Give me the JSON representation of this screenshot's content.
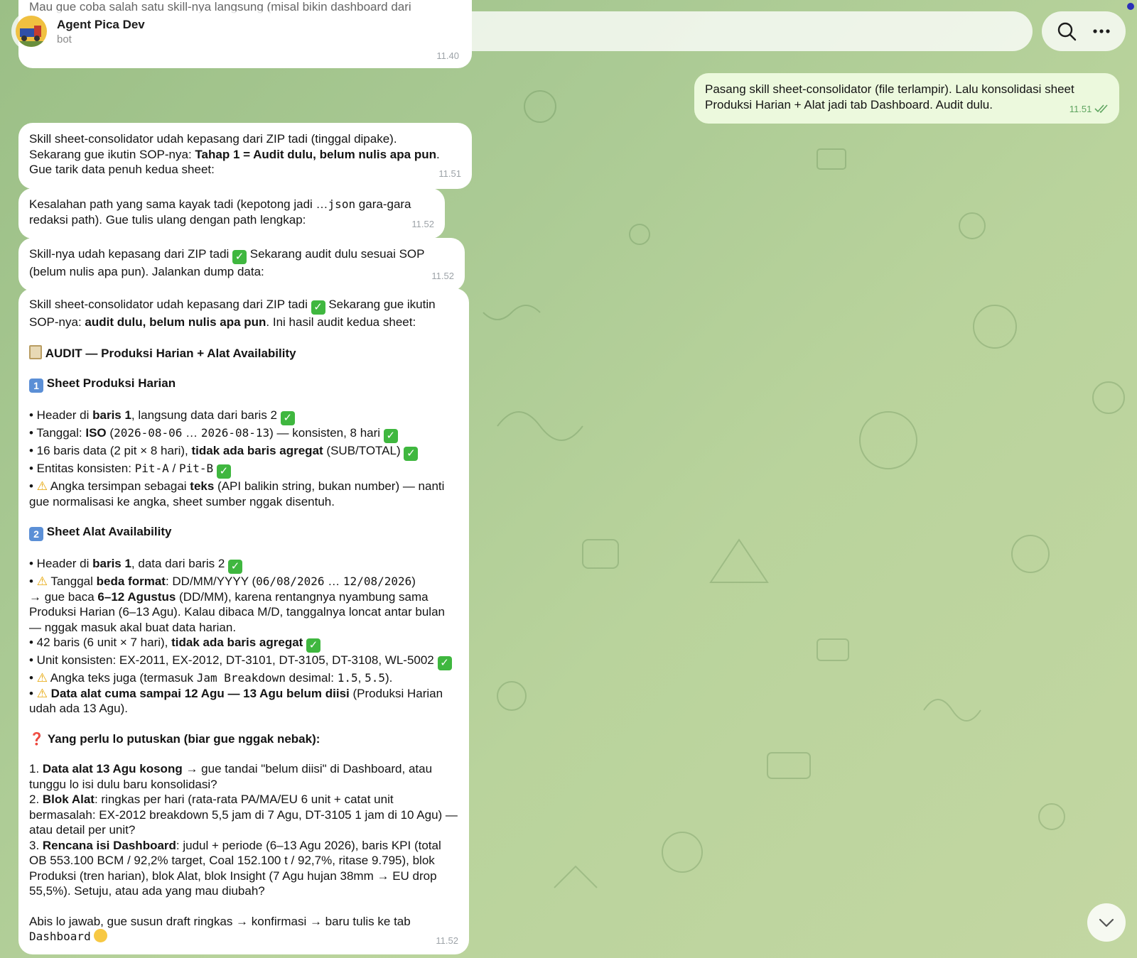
{
  "header": {
    "title": "Agent Pica Dev",
    "subtitle": "bot"
  },
  "top_partial": {
    "text": "Mau gue coba salah satu skill-nya langsung (misal bikin dashboard dari",
    "time": "11.40"
  },
  "outgoing": {
    "text": "Pasang skill sheet-consolidator (file terlampir). Lalu konsolidasi sheet Produksi Harian + Alat jadi tab Dashboard. Audit dulu.",
    "time": "11.51"
  },
  "msg1": {
    "l1": "Skill sheet-consolidator udah kepasang dari ZIP tadi (tinggal dipake).",
    "l2a": "Sekarang gue ikutin SOP-nya: ",
    "l2b": "Tahap 1 = Audit dulu, belum nulis apa pun",
    "l2c": ".",
    "l3": "Gue tarik data penuh kedua sheet:",
    "time": "11.51"
  },
  "msg2": {
    "a": "Kesalahan path yang sama kayak tadi (kepotong jadi …",
    "b": "json",
    "c": " gara-gara redaksi path). Gue tulis ulang dengan path lengkap:",
    "time": "11.52"
  },
  "msg3": {
    "a": "Skill-nya udah kepasang dari ZIP tadi ",
    "b": " Sekarang audit dulu sesuai SOP (belum nulis apa pun). Jalankan dump data:",
    "time": "11.52"
  },
  "msg4": {
    "intro_a": "Skill sheet-consolidator udah kepasang dari ZIP tadi ",
    "intro_b": " Sekarang gue ikutin SOP-nya: ",
    "intro_c": "audit dulu, belum nulis apa pun",
    "intro_d": ". Ini hasil audit kedua sheet:",
    "audit_title": "AUDIT — Produksi Harian + Alat Availability",
    "s1_num": "1",
    "s1_title": "Sheet Produksi Harian",
    "s1_b1a": "• Header di ",
    "s1_b1b": "baris 1",
    "s1_b1c": ", langsung data dari baris 2 ",
    "s1_b2a": "• Tanggal: ",
    "s1_b2b": "ISO",
    "s1_b2c": " (",
    "s1_b2d": "2026-08-06",
    "s1_b2e": " … ",
    "s1_b2f": "2026-08-13",
    "s1_b2g": ") — konsisten, 8 hari ",
    "s1_b3a": "• 16 baris data (2 pit × 8 hari), ",
    "s1_b3b": "tidak ada baris agregat",
    "s1_b3c": " (SUB/TOTAL) ",
    "s1_b4a": "• Entitas konsisten: ",
    "s1_b4b": "Pit-A",
    "s1_b4c": " / ",
    "s1_b4d": "Pit-B",
    "s1_b5a": "• ",
    "s1_b5b": " Angka tersimpan sebagai ",
    "s1_b5c": "teks",
    "s1_b5d": " (API balikin string, bukan number) — nanti gue normalisasi ke angka, sheet sumber nggak disentuh.",
    "s2_num": "2",
    "s2_title": "Sheet Alat Availability",
    "s2_b1a": "• Header di ",
    "s2_b1b": "baris 1",
    "s2_b1c": ", data dari baris 2 ",
    "s2_b2a": "• ",
    "s2_b2b": " Tanggal ",
    "s2_b2c": "beda format",
    "s2_b2d": ": DD/MM/YYYY (",
    "s2_b2e": "06/08/2026",
    "s2_b2f": " … ",
    "s2_b2g": "12/08/2026",
    "s2_b2h": ")",
    "s2_b2i": "→ gue baca ",
    "s2_b2j": "6–12 Agustus",
    "s2_b2k": " (DD/MM), karena rentangnya nyambung sama Produksi Harian (6–13 Agu). Kalau dibaca M/D, tanggalnya loncat antar bulan — nggak masuk akal buat data harian.",
    "s2_b3a": "• 42 baris (6 unit × 7 hari), ",
    "s2_b3b": "tidak ada baris agregat",
    "s2_b4": "• Unit konsisten: EX-2011, EX-2012, DT-3101, DT-3105, DT-3108, WL-5002 ",
    "s2_b5a": "• ",
    "s2_b5b": " Angka teks juga (termasuk ",
    "s2_b5c": "Jam Breakdown",
    "s2_b5d": " desimal: ",
    "s2_b5e": "1.5",
    "s2_b5f": ", ",
    "s2_b5g": "5.5",
    "s2_b5h": ").",
    "s2_b6a": "• ",
    "s2_b6b": " Data alat cuma sampai 12 Agu — 13 Agu belum diisi",
    "s2_b6c": " (Produksi Harian udah ada 13 Agu).",
    "q_title": "Yang perlu lo putuskan (biar gue nggak nebak):",
    "q1a": "1. ",
    "q1b": "Data alat 13 Agu kosong",
    "q1c": " → gue tandai \"belum diisi\" di Dashboard, atau tunggu lo isi dulu baru konsolidasi?",
    "q2a": "2. ",
    "q2b": "Blok Alat",
    "q2c": ": ringkas per hari (rata-rata PA/MA/EU 6 unit + catat unit bermasalah: EX-2012 breakdown 5,5 jam di 7 Agu, DT-3105 1 jam di 10 Agu) — atau detail per unit?",
    "q3a": "3. ",
    "q3b": "Rencana isi Dashboard",
    "q3c": ": judul + periode (6–13 Agu 2026), baris KPI (total OB 553.100 BCM / 92,2% target, Coal 152.100 t / 92,7%, ritase 9.795), blok Produksi (tren harian), blok Alat, blok Insight (7 Agu hujan 38mm → EU drop 55,5%). Setuju, atau ada yang mau diubah?",
    "outro_a": "Abis lo jawab, gue susun draft ringkas → konfirmasi → baru tulis ke tab ",
    "outro_b": "Dashboard",
    "time": "11.52"
  },
  "icons": [
    "search-icon",
    "more-icon",
    "chevron-down-icon",
    "check-icon",
    "warning-icon",
    "clipboard-icon",
    "question-icon",
    "smile-icon",
    "double-check-icon"
  ],
  "colors": {
    "outgoing_bubble": "#ecf9dd",
    "incoming_bubble": "#ffffff",
    "check_emoji": "#3fb73f",
    "warning": "#e6a400"
  }
}
